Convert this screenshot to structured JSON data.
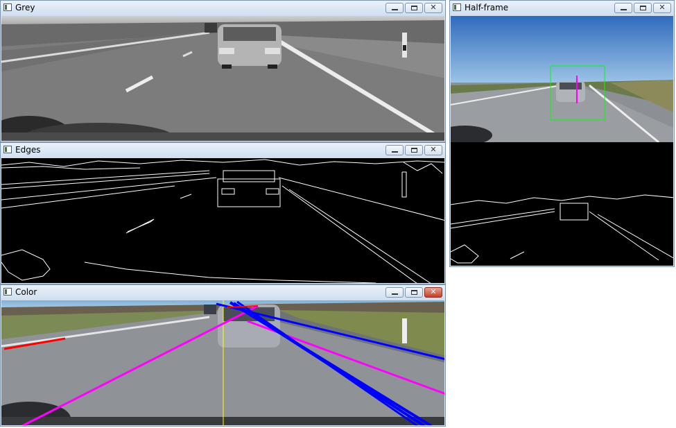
{
  "windows": {
    "grey": {
      "title": "Grey"
    },
    "edges": {
      "title": "Edges"
    },
    "color": {
      "title": "Color"
    },
    "half": {
      "title": "Half-frame"
    }
  },
  "controls": {
    "minimize": "▁",
    "maximize": "□",
    "close": "✕"
  },
  "colors": {
    "detected_lines": "#0000ff",
    "extrapolated_lines": "#ff00ff",
    "left_lane": "#ff0000",
    "center_line": "#ffff00",
    "bounding_box": "#00ff00"
  }
}
